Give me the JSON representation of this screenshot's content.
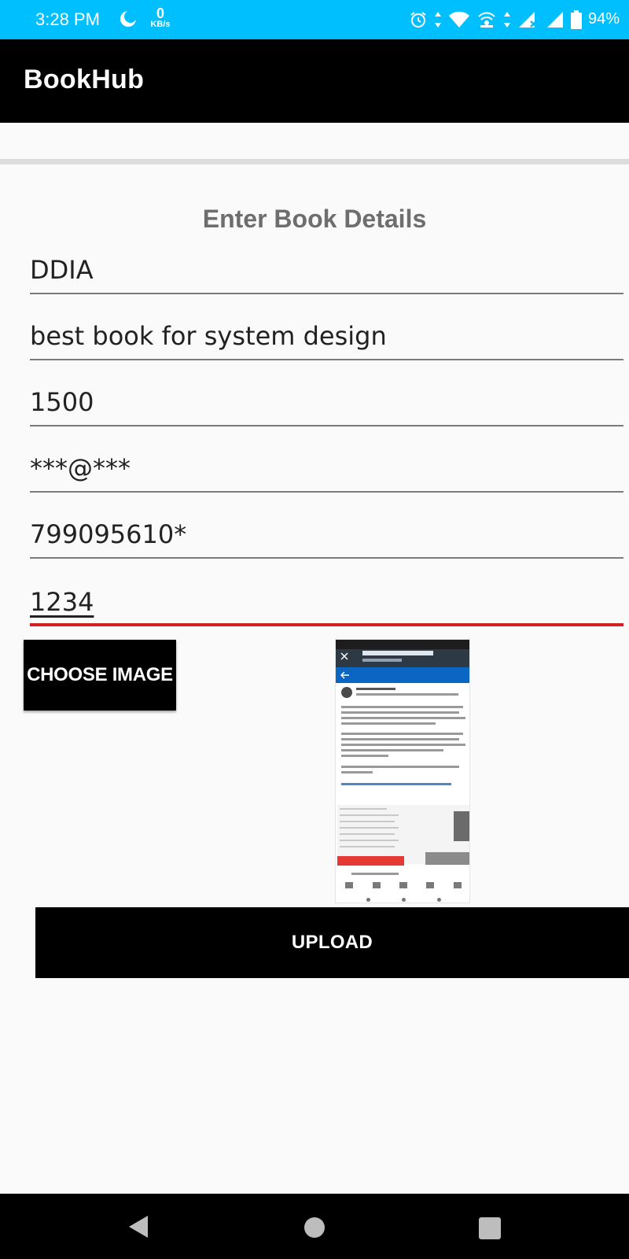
{
  "status_bar": {
    "time": "3:28 PM",
    "net_speed_value": "0",
    "net_speed_unit": "KB/s",
    "battery_text": "94%",
    "icons": [
      "moon-icon",
      "alarm-icon",
      "wifi-icon",
      "hotspot-icon",
      "signal-icon",
      "battery-icon"
    ]
  },
  "app_bar": {
    "title": "BookHub"
  },
  "form": {
    "heading": "Enter Book Details",
    "fields": [
      {
        "value": "DDIA"
      },
      {
        "value": "best book for system design"
      },
      {
        "value": "1500"
      },
      {
        "value": "***@***"
      },
      {
        "value": "799095610*"
      },
      {
        "value": "1234"
      }
    ],
    "choose_image_label": "CHOOSE IMAGE",
    "upload_label": "UPLOAD"
  },
  "colors": {
    "status_bar": "#00bfff",
    "app_bar": "#000000",
    "active_underline": "#d32020",
    "heading": "#6e6e6e"
  }
}
